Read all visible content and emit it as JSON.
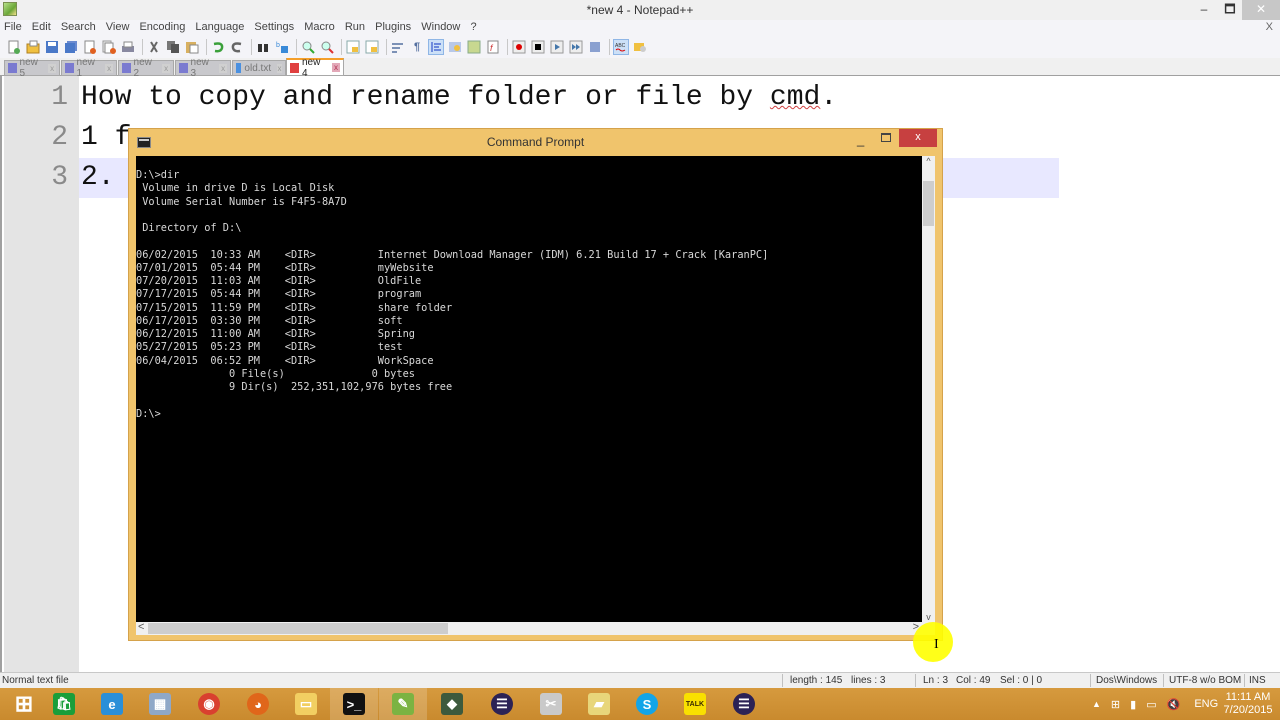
{
  "window": {
    "title": "*new  4 - Notepad++",
    "min_label": "‒",
    "max_label": "🗖",
    "close_label": "✕"
  },
  "menu": {
    "items": [
      "File",
      "Edit",
      "Search",
      "View",
      "Encoding",
      "Language",
      "Settings",
      "Macro",
      "Run",
      "Plugins",
      "Window",
      "?"
    ],
    "close_label": "X"
  },
  "toolbar": {
    "buttons": [
      {
        "icon": "new-file-icon"
      },
      {
        "icon": "open-file-icon"
      },
      {
        "icon": "save-icon"
      },
      {
        "icon": "save-all-icon"
      },
      {
        "icon": "close-file-icon"
      },
      {
        "icon": "close-all-icon"
      },
      {
        "icon": "print-icon"
      },
      {
        "icon": "cut-icon"
      },
      {
        "icon": "copy-icon"
      },
      {
        "icon": "paste-icon"
      },
      {
        "icon": "undo-icon"
      },
      {
        "icon": "redo-icon"
      },
      {
        "icon": "find-icon"
      },
      {
        "icon": "replace-icon"
      },
      {
        "icon": "zoom-in-icon"
      },
      {
        "icon": "zoom-out-icon"
      },
      {
        "icon": "sync-vertical-icon"
      },
      {
        "icon": "sync-horizontal-icon"
      },
      {
        "icon": "word-wrap-icon"
      },
      {
        "icon": "show-all-chars-icon"
      },
      {
        "icon": "indent-guide-icon"
      },
      {
        "icon": "udl-icon"
      },
      {
        "icon": "doc-map-icon"
      },
      {
        "icon": "function-list-icon"
      },
      {
        "icon": "record-macro-icon"
      },
      {
        "icon": "stop-macro-icon"
      },
      {
        "icon": "play-macro-icon"
      },
      {
        "icon": "run-macro-multiple-icon"
      },
      {
        "icon": "save-macro-icon"
      },
      {
        "icon": "spell-check-icon"
      },
      {
        "icon": "plugin-icon"
      }
    ]
  },
  "tabs": [
    {
      "label": "new 5",
      "active": false
    },
    {
      "label": "new 1",
      "active": false
    },
    {
      "label": "new 2",
      "active": false
    },
    {
      "label": "new 3",
      "active": false
    },
    {
      "label": "old.txt",
      "active": false
    },
    {
      "label": "new 4",
      "active": true
    }
  ],
  "editor": {
    "lines": [
      {
        "num": "1",
        "pre": "How to copy and rename folder or file by ",
        "spell": "cmd",
        "post": "."
      },
      {
        "num": "2",
        "text": "1 f                                  ame."
      },
      {
        "num": "3",
        "text": "2.                                   older",
        "brace": ")"
      }
    ]
  },
  "cmd": {
    "title": "Command Prompt",
    "min_label": "_",
    "close_label": "x",
    "output": [
      "D:\\>dir",
      " Volume in drive D is Local Disk",
      " Volume Serial Number is F4F5-8A7D",
      "",
      " Directory of D:\\",
      "",
      "06/02/2015  10:33 AM    <DIR>          Internet Download Manager (IDM) 6.21 Build 17 + Crack [KaranPC]",
      "07/01/2015  05:44 PM    <DIR>          myWebsite",
      "07/20/2015  11:03 AM    <DIR>          OldFile",
      "07/17/2015  05:44 PM    <DIR>          program",
      "07/15/2015  11:59 PM    <DIR>          share folder",
      "06/17/2015  03:30 PM    <DIR>          soft",
      "06/12/2015  11:00 AM    <DIR>          Spring",
      "05/27/2015  05:23 PM    <DIR>          test",
      "06/04/2015  06:52 PM    <DIR>          WorkSpace",
      "               0 File(s)              0 bytes",
      "               9 Dir(s)  252,351,102,976 bytes free",
      "",
      "D:\\>"
    ]
  },
  "status": {
    "file_type": "Normal text file",
    "length": "length : 145",
    "lines": "lines : 3",
    "ln": "Ln : 3",
    "col": "Col : 49",
    "sel": "Sel : 0 | 0",
    "eol": "Dos\\Windows",
    "encoding": "UTF-8 w/o BOM",
    "mode": "INS"
  },
  "taskbar": {
    "apps": [
      {
        "name": "start",
        "glyph": "⊞",
        "color": "#ffffff"
      },
      {
        "name": "store",
        "glyph": "🛍",
        "color": "#1a9e3a"
      },
      {
        "name": "internet-explorer",
        "glyph": "e",
        "color": "#2a8fd8"
      },
      {
        "name": "calculator",
        "glyph": "▦",
        "color": "#8fa8c8"
      },
      {
        "name": "chrome",
        "glyph": "◉",
        "color": "#d9402f"
      },
      {
        "name": "firefox",
        "glyph": "◕",
        "color": "#e0661a"
      },
      {
        "name": "file-explorer",
        "glyph": "▭",
        "color": "#f2cf62"
      },
      {
        "name": "command-prompt",
        "glyph": ">_",
        "color": "#111111"
      },
      {
        "name": "notepad-plus-plus",
        "glyph": "✎",
        "color": "#7bb342"
      },
      {
        "name": "android-studio",
        "glyph": "◆",
        "color": "#3d5a3d"
      },
      {
        "name": "eclipse",
        "glyph": "☰",
        "color": "#2c2255"
      },
      {
        "name": "snipping-tool",
        "glyph": "✂",
        "color": "#c9c9c9"
      },
      {
        "name": "sticky-notes",
        "glyph": "▰",
        "color": "#e8d67a"
      },
      {
        "name": "skype",
        "glyph": "S",
        "color": "#12a5e8"
      },
      {
        "name": "kakaotalk",
        "glyph": "TALK",
        "color": "#f9e000"
      },
      {
        "name": "eclipse-2",
        "glyph": "☰",
        "color": "#2c2255"
      }
    ],
    "language": "ENG",
    "time": "11:11 AM",
    "date": "7/20/2015"
  }
}
